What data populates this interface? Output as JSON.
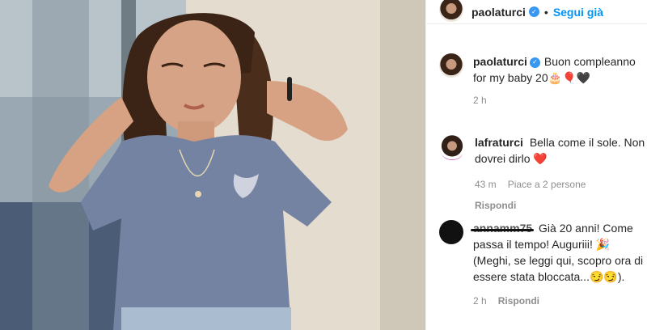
{
  "header": {
    "username": "paolaturci",
    "separator": "•",
    "follow_label": "Segui già"
  },
  "caption": {
    "username": "paolaturci",
    "text": "Buon compleanno for my baby 20🎂🎈🖤",
    "time": "2 h"
  },
  "comments": [
    {
      "username": "lafraturci",
      "text": "Bella come il sole. Non dovrei dirlo ❤️",
      "time": "43 m",
      "likes": "Piace a 2 persone",
      "reply_label": "Rispondi"
    },
    {
      "username": "annamm75",
      "text": "Già 20 anni! Come passa il tempo! Auguriii! 🎉 (Meghi, se leggi qui, scopro ora di essere stata bloccata...😏😏).",
      "time": "2 h",
      "reply_label": "Rispondi"
    }
  ],
  "icons": {
    "verified": "verified-check-icon"
  },
  "colors": {
    "link_blue": "#0095f6",
    "verified_blue": "#3897f0",
    "muted": "#8e8e8e"
  }
}
